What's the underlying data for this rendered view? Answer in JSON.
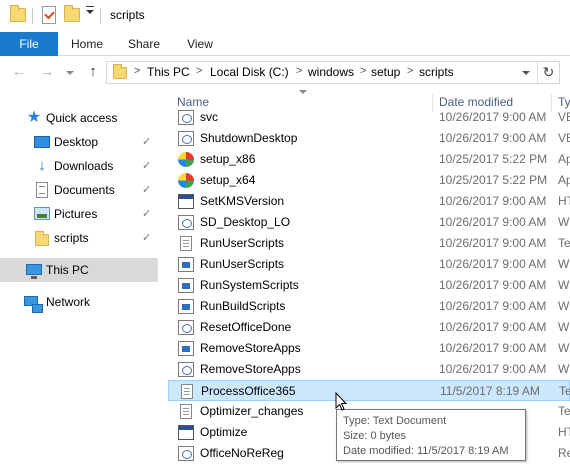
{
  "window": {
    "title": "scripts"
  },
  "ribbon": {
    "tabs": [
      {
        "label": "File",
        "active": true
      },
      {
        "label": "Home"
      },
      {
        "label": "Share"
      },
      {
        "label": "View"
      }
    ],
    "accent_color": "#1979ca"
  },
  "address": {
    "crumbs": [
      "This PC",
      "Local Disk (C:)",
      "windows",
      "setup",
      "scripts"
    ],
    "separator": ">",
    "back_icon": "←",
    "forward_icon": "→",
    "up_icon": "↑",
    "refresh_icon": "↻"
  },
  "nav": {
    "pin_icon": "✓",
    "star_icon": "★",
    "down_icon": "↓",
    "quick_access": "Quick access",
    "items": [
      {
        "label": "Desktop",
        "icon": "desktop-icon",
        "pinned": true
      },
      {
        "label": "Downloads",
        "icon": "download-icon",
        "pinned": true
      },
      {
        "label": "Documents",
        "icon": "documents-icon",
        "pinned": true
      },
      {
        "label": "Pictures",
        "icon": "pictures-icon",
        "pinned": true
      },
      {
        "label": "scripts",
        "icon": "folder-icon",
        "pinned": true
      }
    ],
    "this_pc": "This PC",
    "network": "Network"
  },
  "columns": {
    "name": "Name",
    "date_modified": "Date modified",
    "type": "Ty"
  },
  "files": [
    {
      "name": "svc",
      "date": "10/26/2017 9:00 AM",
      "type": "VE",
      "icon": "script-icon"
    },
    {
      "name": "ShutdownDesktop",
      "date": "10/26/2017 9:00 AM",
      "type": "VE",
      "icon": "script-icon"
    },
    {
      "name": "setup_x86",
      "date": "10/25/2017 5:22 PM",
      "type": "Ap",
      "icon": "setup-icon"
    },
    {
      "name": "setup_x64",
      "date": "10/25/2017 5:22 PM",
      "type": "Ap",
      "icon": "setup-icon"
    },
    {
      "name": "SetKMSVersion",
      "date": "10/26/2017 9:00 AM",
      "type": "HT",
      "icon": "hta-icon"
    },
    {
      "name": "SD_Desktop_LO",
      "date": "10/26/2017 9:00 AM",
      "type": "W",
      "icon": "script-icon"
    },
    {
      "name": "RunUserScripts",
      "date": "10/26/2017 9:00 AM",
      "type": "Te",
      "icon": "text-icon"
    },
    {
      "name": "RunUserScripts",
      "date": "10/26/2017 9:00 AM",
      "type": "W",
      "icon": "powershell-icon"
    },
    {
      "name": "RunSystemScripts",
      "date": "10/26/2017 9:00 AM",
      "type": "W",
      "icon": "powershell-icon"
    },
    {
      "name": "RunBuildScripts",
      "date": "10/26/2017 9:00 AM",
      "type": "W",
      "icon": "powershell-icon"
    },
    {
      "name": "ResetOfficeDone",
      "date": "10/26/2017 9:00 AM",
      "type": "W",
      "icon": "script-icon"
    },
    {
      "name": "RemoveStoreApps",
      "date": "10/26/2017 9:00 AM",
      "type": "W",
      "icon": "powershell-icon"
    },
    {
      "name": "RemoveStoreApps",
      "date": "10/26/2017 9:00 AM",
      "type": "W",
      "icon": "script-icon"
    },
    {
      "name": "ProcessOffice365",
      "date": "11/5/2017 8:19 AM",
      "type": "Te",
      "icon": "text-icon",
      "selected": true
    },
    {
      "name": "Optimizer_changes",
      "date": "",
      "type": "Te",
      "icon": "text-icon"
    },
    {
      "name": "Optimize",
      "date": "",
      "type": "HT",
      "icon": "hta-icon"
    },
    {
      "name": "OfficeNoReReg",
      "date": "",
      "type": "Re",
      "icon": "script-icon"
    },
    {
      "name": "",
      "date": "",
      "type": "",
      "icon": "script-icon"
    }
  ],
  "tooltip": {
    "type": "Type: Text Document",
    "size": "Size: 0 bytes",
    "date": "Date modified: 11/5/2017 8:19 AM"
  }
}
